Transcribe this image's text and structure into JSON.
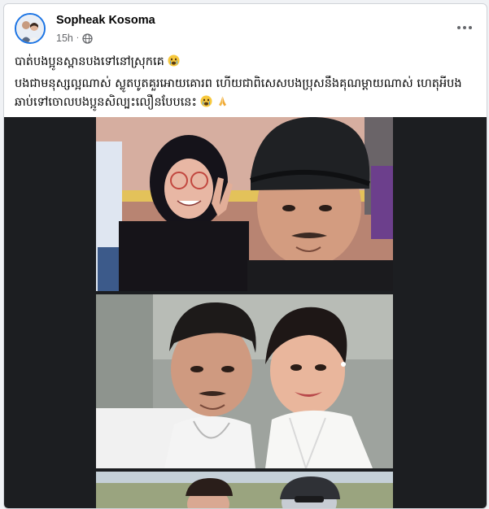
{
  "post": {
    "author": "Sopheak Kosoma",
    "timestamp": "15h",
    "separator": "·",
    "privacy_icon": "globe-icon",
    "more_icon": "more-options-icon",
    "caption_line1": "បាត់បងប្អូនស្ពានបងទៅនៅស្រុកគេ",
    "caption_line2": "បងជាមនុស្សល្អណាស់ ស្លូតបូតគួរអោយគោរព ហើយជាពិសេសបងប្រុសនឹងគុណម្តាយណាស់ ហេតុអីបងឆាប់ទៅចោលបងប្អូនសិល្បះលឿនបែបនេះ",
    "emoji_line1": "crying-face-icon",
    "emoji_line2": [
      "crying-face-icon",
      "folded-hands-icon"
    ]
  },
  "colors": {
    "accent": "#1b74e4",
    "text": "#050505",
    "secondary_text": "#65676b",
    "media_background": "#1c1e21"
  },
  "media": {
    "photos": [
      "photo-selfie-outdoor",
      "photo-selfie-couple",
      "photo-partial-third"
    ]
  }
}
